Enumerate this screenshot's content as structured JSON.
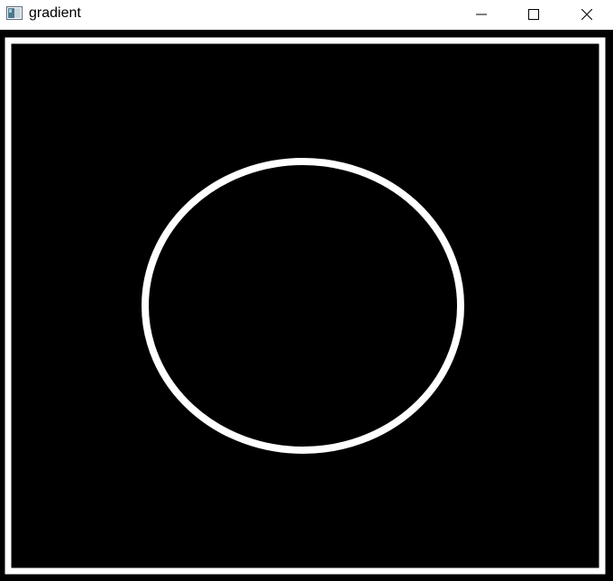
{
  "window": {
    "title": "gradient",
    "icon": "app-window-icon",
    "controls": {
      "minimize_icon": "minimize-icon",
      "maximize_icon": "maximize-icon",
      "close_icon": "close-icon"
    }
  },
  "image": {
    "background_color": "#000000",
    "stroke_color": "#ffffff",
    "shapes": [
      "rectangle-outline",
      "ellipse-outline"
    ]
  }
}
